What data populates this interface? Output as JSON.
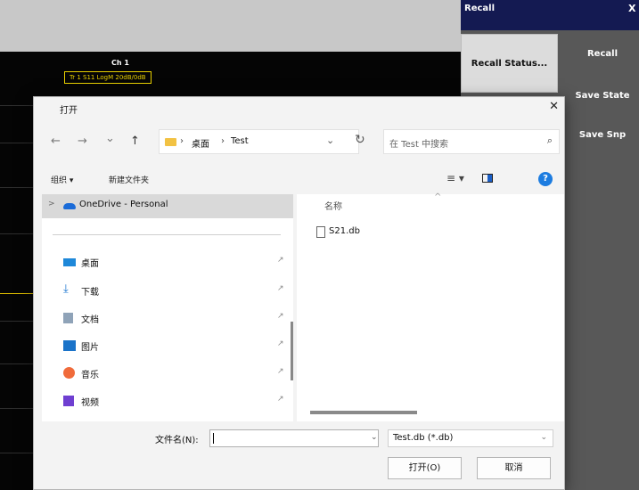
{
  "instrument": {
    "channel_label": "Ch 1",
    "trace_label": "Tr 1 S11 LogM 20dB/0dB"
  },
  "recall_panel": {
    "title": "Recall",
    "close": "X",
    "recall_status_button": "Recall Status...",
    "buttons": [
      "Recall",
      "Save State",
      "Save Snp"
    ]
  },
  "dialog": {
    "title": "打开",
    "close": "✕",
    "nav": {
      "back": "←",
      "forward": "→",
      "recent": "⌄",
      "up": "↑"
    },
    "breadcrumb": [
      "桌面",
      "Test"
    ],
    "breadcrumb_separator": "›",
    "address_dropdown": "⌄",
    "refresh": "↻",
    "search_placeholder": "在 Test 中搜索",
    "toolbar": {
      "organize": "组织 ▾",
      "new_folder": "新建文件夹",
      "view": "≡ ▾",
      "help": "?"
    },
    "sidebar": {
      "onedrive": "OneDrive - Personal",
      "items": [
        {
          "label": "桌面",
          "icon": "desktop-icon",
          "color": "#1e88d9"
        },
        {
          "label": "下载",
          "icon": "download-icon",
          "color": "#1e78d0"
        },
        {
          "label": "文档",
          "icon": "document-icon",
          "color": "#7b8a99"
        },
        {
          "label": "图片",
          "icon": "pictures-icon",
          "color": "#1a73c9"
        },
        {
          "label": "音乐",
          "icon": "music-icon",
          "color": "#f06b3b"
        },
        {
          "label": "视频",
          "icon": "video-icon",
          "color": "#6f3fd1"
        }
      ],
      "pin": "📌"
    },
    "file_list": {
      "column_name": "名称",
      "files": [
        "S21.db"
      ]
    },
    "file_name_label": "文件名(N):",
    "file_name_value": "",
    "file_type": "Test.db (*.db)",
    "open_button": "打开(O)",
    "cancel_button": "取消"
  }
}
